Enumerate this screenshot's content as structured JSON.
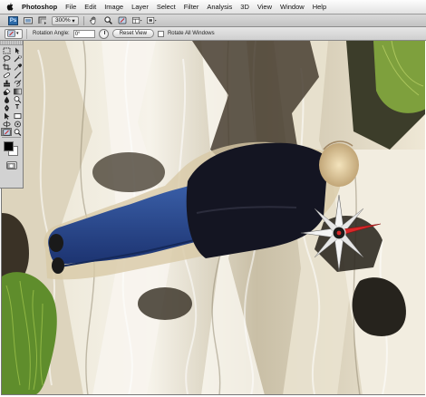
{
  "menubar": {
    "items": [
      "Photoshop",
      "File",
      "Edit",
      "Image",
      "Layer",
      "Select",
      "Filter",
      "Analysis",
      "3D",
      "View",
      "Window",
      "Help"
    ]
  },
  "appbar": {
    "zoom": "300%"
  },
  "options": {
    "rotation_label": "Rotation Angle:",
    "rotation_value": "0°",
    "reset_label": "Reset View",
    "rotate_all_label": "Rotate All Windows",
    "rotate_all_checked": false
  },
  "toolbox": {
    "active_tool": "rotate-view-tool",
    "type_tool_glyph": "T",
    "foreground_color": "#000000",
    "background_color": "#ffffff"
  },
  "canvas": {
    "compass_needle_color": "#d8282a"
  }
}
